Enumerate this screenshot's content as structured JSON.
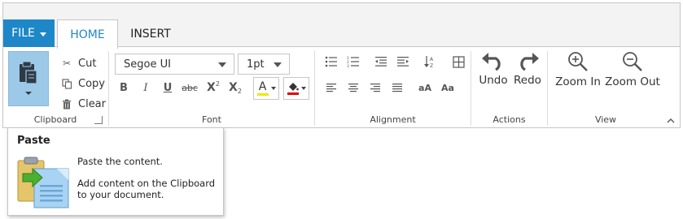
{
  "tabs": {
    "file_label": "FILE",
    "home_label": "HOME",
    "insert_label": "INSERT"
  },
  "clipboard": {
    "group_label": "Clipboard",
    "cut_label": "Cut",
    "copy_label": "Copy",
    "clear_label": "Clear"
  },
  "font": {
    "group_label": "Font",
    "family_value": "Segoe UI",
    "size_value": "1pt",
    "bold_label": "B",
    "italic_label": "I",
    "underline_label": "U",
    "strike_label": "abc",
    "superscript_label": "X",
    "subscript_label": "X",
    "font_color_glyph": "A",
    "font_color": "#f2e600",
    "highlight_color": "#e00000"
  },
  "alignment": {
    "group_label": "Alignment",
    "uppercase_label": "aA",
    "capitalize_label": "Aa"
  },
  "actions": {
    "group_label": "Actions",
    "undo_label": "Undo",
    "redo_label": "Redo"
  },
  "view": {
    "group_label": "View",
    "zoom_in_label": "Zoom In",
    "zoom_out_label": "Zoom Out"
  },
  "tooltip": {
    "title": "Paste",
    "line1": "Paste the content.",
    "line2": "Add content on the Clipboard",
    "line3": "to your document."
  },
  "colors": {
    "accent": "#1e87c8",
    "paste_active": "#9dc9e8"
  }
}
